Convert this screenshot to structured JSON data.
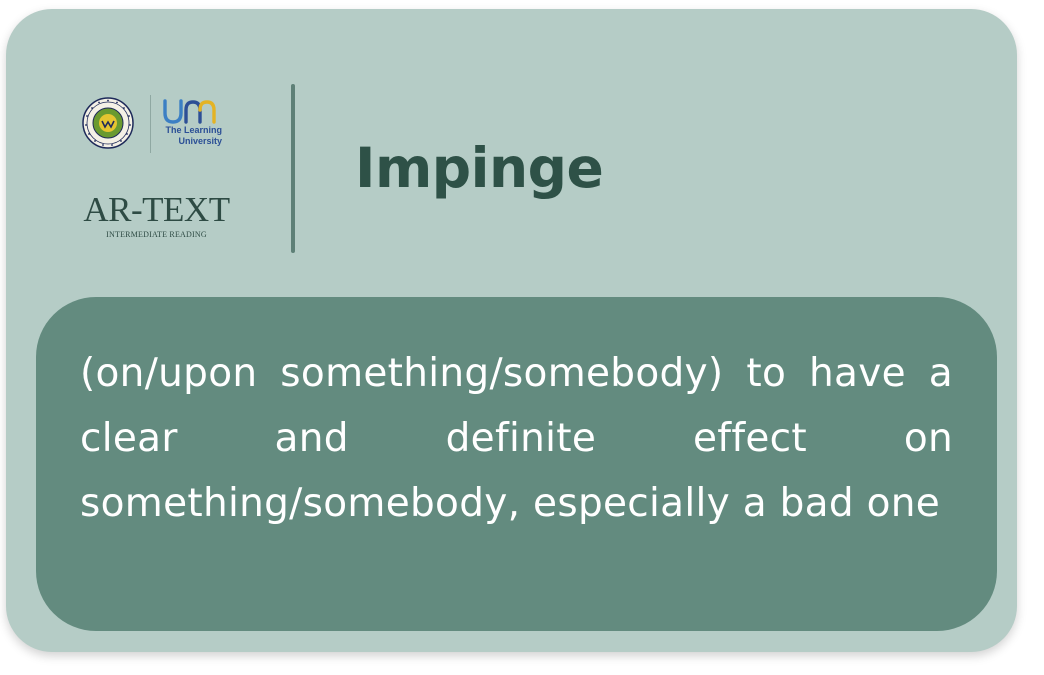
{
  "card": {
    "background_color": "#b5ccc6",
    "definition_panel_color": "#638b7f",
    "title_color": "#2e5147"
  },
  "logos": {
    "seal_icon": "university-seal-icon",
    "um_logo_icon": "um-logo-icon",
    "um_tagline_line1": "The Learning",
    "um_tagline_line2": "University",
    "brand_name": "AR-TEXT",
    "brand_subtitle": "INTERMEDIATE READING"
  },
  "entry": {
    "word": "Impinge",
    "definition": "(on/upon something/somebody) to have a clear and definite effect on something/somebody, especially a bad one"
  }
}
